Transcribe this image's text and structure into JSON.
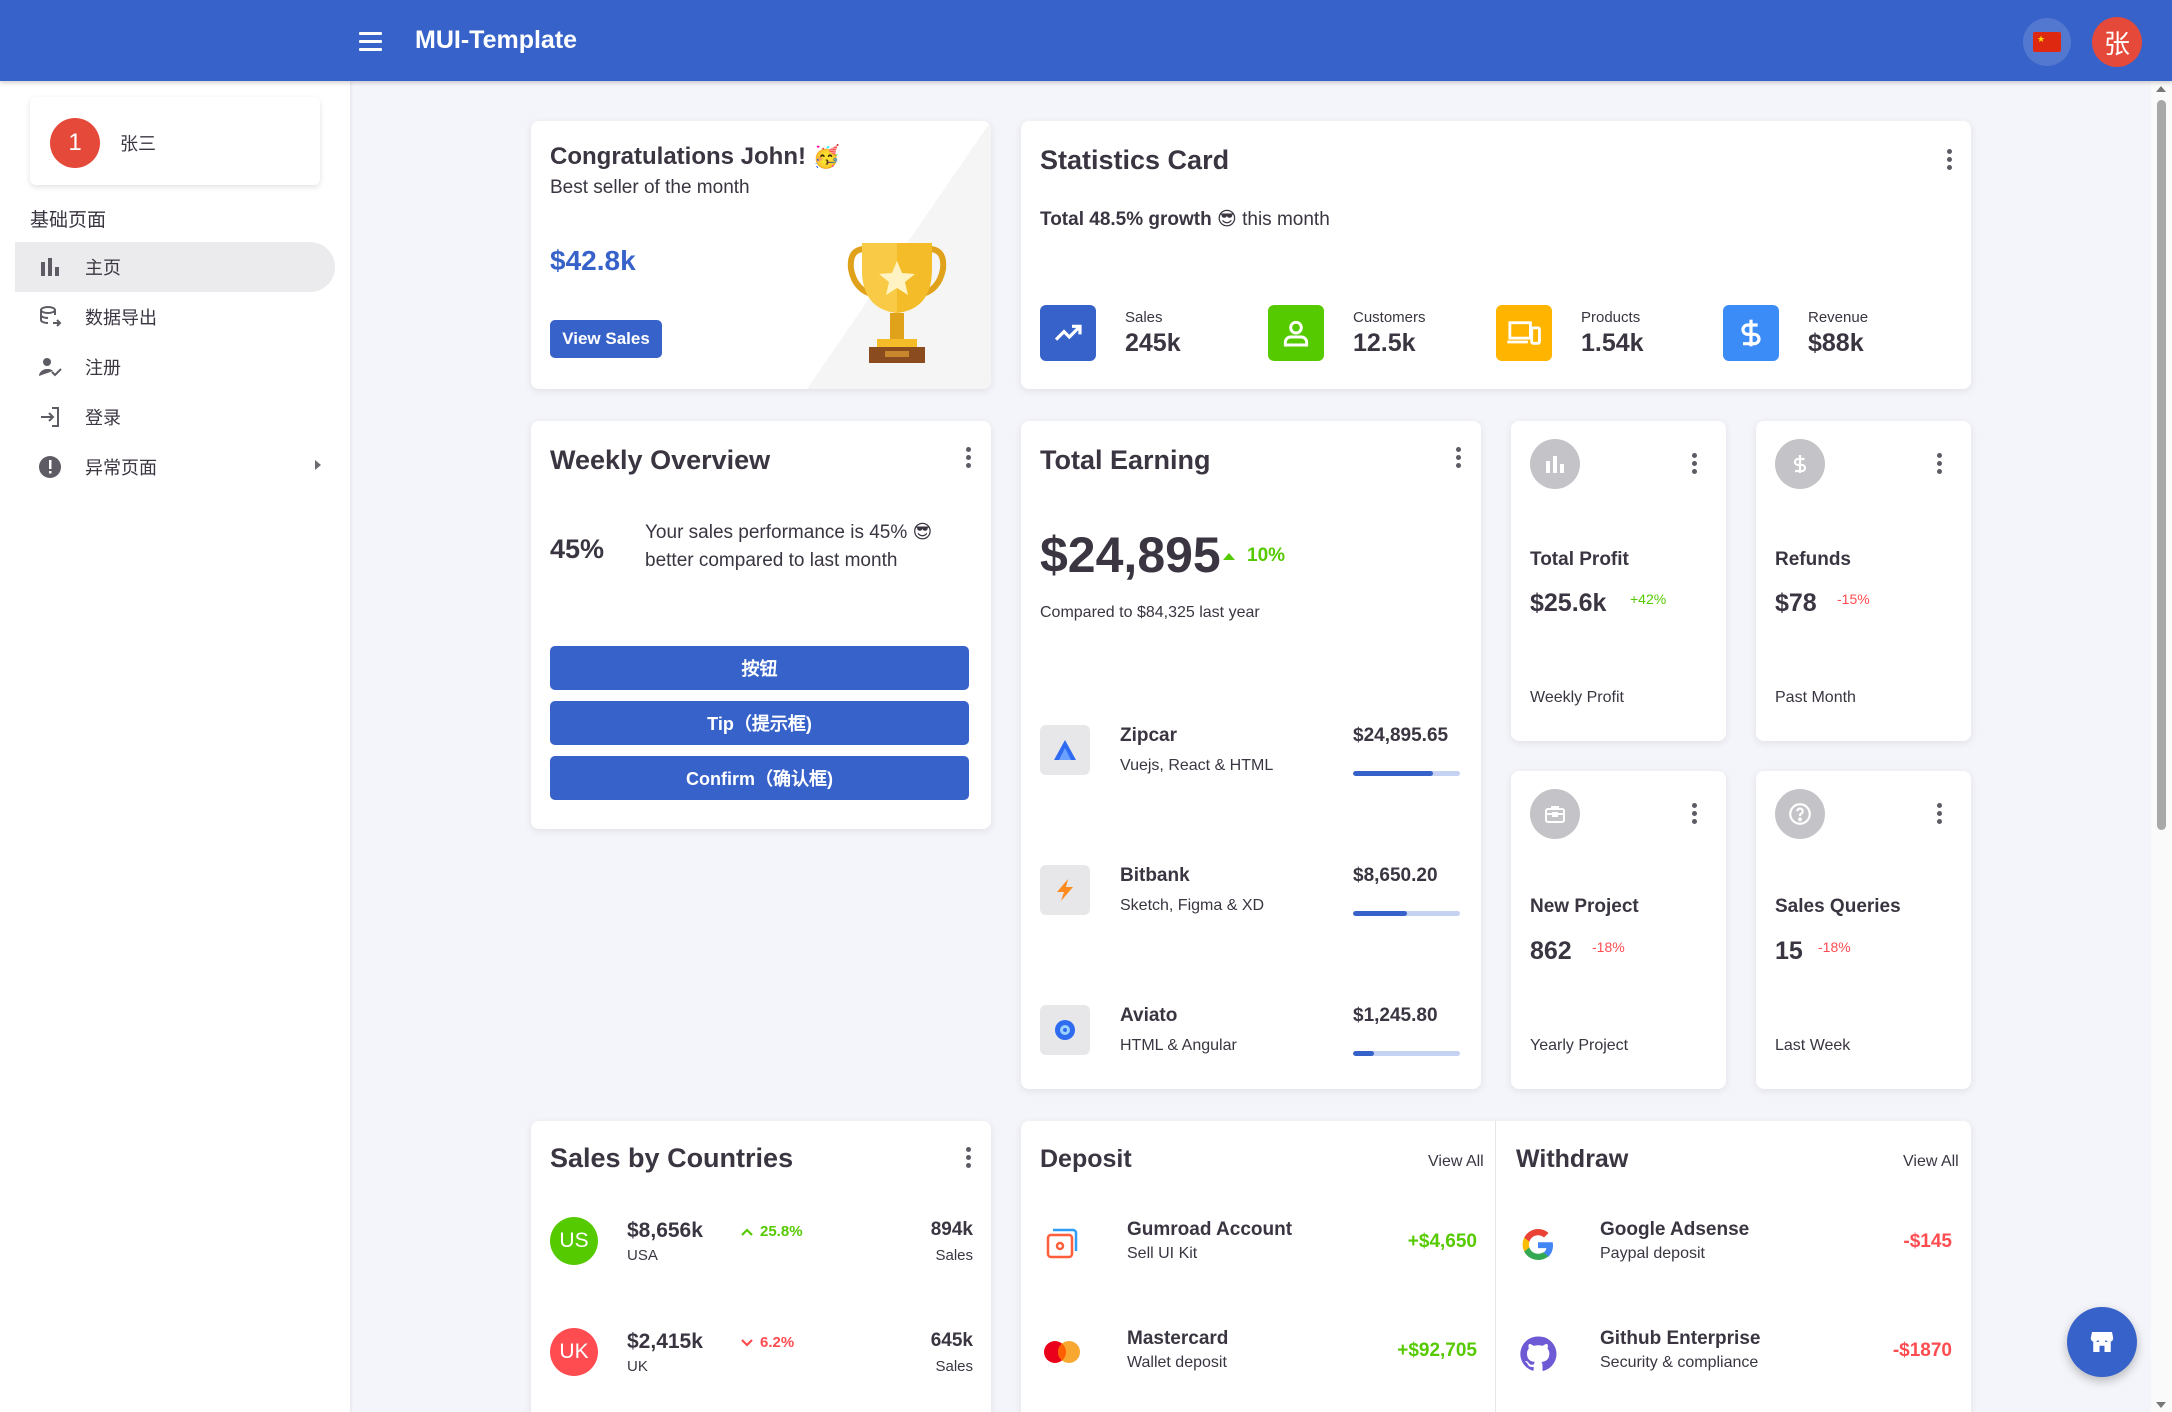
{
  "header": {
    "title": "MUI-Template",
    "user_initial": "张",
    "language": "中文"
  },
  "colors": {
    "primary": "#3762c9",
    "success": "#56ca00",
    "error": "#ff4c51",
    "warning": "#ffb400",
    "info": "#16b1ff",
    "avatar": "#e5493a"
  },
  "sidebar": {
    "profile": {
      "initial": "1",
      "name": "张三"
    },
    "section": "基础页面",
    "items": [
      {
        "label": "主页",
        "icon": "bar-chart-icon",
        "active": true
      },
      {
        "label": "数据导出",
        "icon": "database-export-icon"
      },
      {
        "label": "注册",
        "icon": "user-check-icon"
      },
      {
        "label": "登录",
        "icon": "login-icon"
      },
      {
        "label": "异常页面",
        "icon": "alert-circle-icon",
        "has_submenu": true
      }
    ]
  },
  "congrats": {
    "title": "Congratulations John!",
    "subtitle": "Best seller of the month",
    "amount": "$42.8k",
    "button": "View Sales",
    "icon": "trophy-icon"
  },
  "statistics": {
    "title": "Statistics Card",
    "growth_bold": "Total 48.5% growth",
    "growth_rest": "this month",
    "items": [
      {
        "label": "Sales",
        "value": "245k",
        "icon": "trending-up-icon",
        "color": "#3762c9"
      },
      {
        "label": "Customers",
        "value": "12.5k",
        "icon": "user-icon",
        "color": "#56ca00"
      },
      {
        "label": "Products",
        "value": "1.54k",
        "icon": "devices-icon",
        "color": "#ffb400"
      },
      {
        "label": "Revenue",
        "value": "$88k",
        "icon": "dollar-icon",
        "color": "#3b8cf6"
      }
    ]
  },
  "weekly": {
    "title": "Weekly Overview",
    "percent": "45%",
    "text": "Your sales performance is 45% 😎 better compared to last month",
    "buttons": [
      "按钮",
      "Tip（提示框)",
      "Confirm（确认框)"
    ]
  },
  "earning": {
    "title": "Total Earning",
    "amount": "$24,895",
    "change": "10%",
    "compare": "Compared to $84,325 last year",
    "items": [
      {
        "name": "Zipcar",
        "sub": "Vuejs, React & HTML",
        "amount": "$24,895.65",
        "progress": 75
      },
      {
        "name": "Bitbank",
        "sub": "Sketch, Figma & XD",
        "amount": "$8,650.20",
        "progress": 50
      },
      {
        "name": "Aviato",
        "sub": "HTML & Angular",
        "amount": "$1,245.80",
        "progress": 20
      }
    ]
  },
  "mini": [
    {
      "title": "Total Profit",
      "value": "$25.6k",
      "change": "+42%",
      "foot": "Weekly Profit",
      "icon": "bar-chart-icon",
      "positive": true
    },
    {
      "title": "Refunds",
      "value": "$78",
      "change": "-15%",
      "foot": "Past Month",
      "icon": "dollar-icon",
      "positive": false
    },
    {
      "title": "New Project",
      "value": "862",
      "change": "-18%",
      "foot": "Yearly Project",
      "icon": "briefcase-icon",
      "positive": false
    },
    {
      "title": "Sales Queries",
      "value": "15",
      "change": "-18%",
      "foot": "Last Week",
      "icon": "help-circle-icon",
      "positive": false
    }
  ],
  "countries": {
    "title": "Sales by Countries",
    "items": [
      {
        "code": "US",
        "amount": "$8,656k",
        "change": "25.8%",
        "up": true,
        "country": "USA",
        "sales": "894k",
        "sales_label": "Sales",
        "color": "#56ca00"
      },
      {
        "code": "UK",
        "amount": "$2,415k",
        "change": "6.2%",
        "up": false,
        "country": "UK",
        "sales": "645k",
        "sales_label": "Sales",
        "color": "#ff4c51"
      }
    ]
  },
  "deposit": {
    "title": "Deposit",
    "view_all": "View All",
    "items": [
      {
        "name": "Gumroad Account",
        "sub": "Sell UI Kit",
        "amount": "+$4,650"
      },
      {
        "name": "Mastercard",
        "sub": "Wallet deposit",
        "amount": "+$92,705"
      }
    ]
  },
  "withdraw": {
    "title": "Withdraw",
    "view_all": "View All",
    "items": [
      {
        "name": "Google Adsense",
        "sub": "Paypal deposit",
        "amount": "-$145"
      },
      {
        "name": "Github Enterprise",
        "sub": "Security & compliance",
        "amount": "-$1870"
      }
    ]
  }
}
